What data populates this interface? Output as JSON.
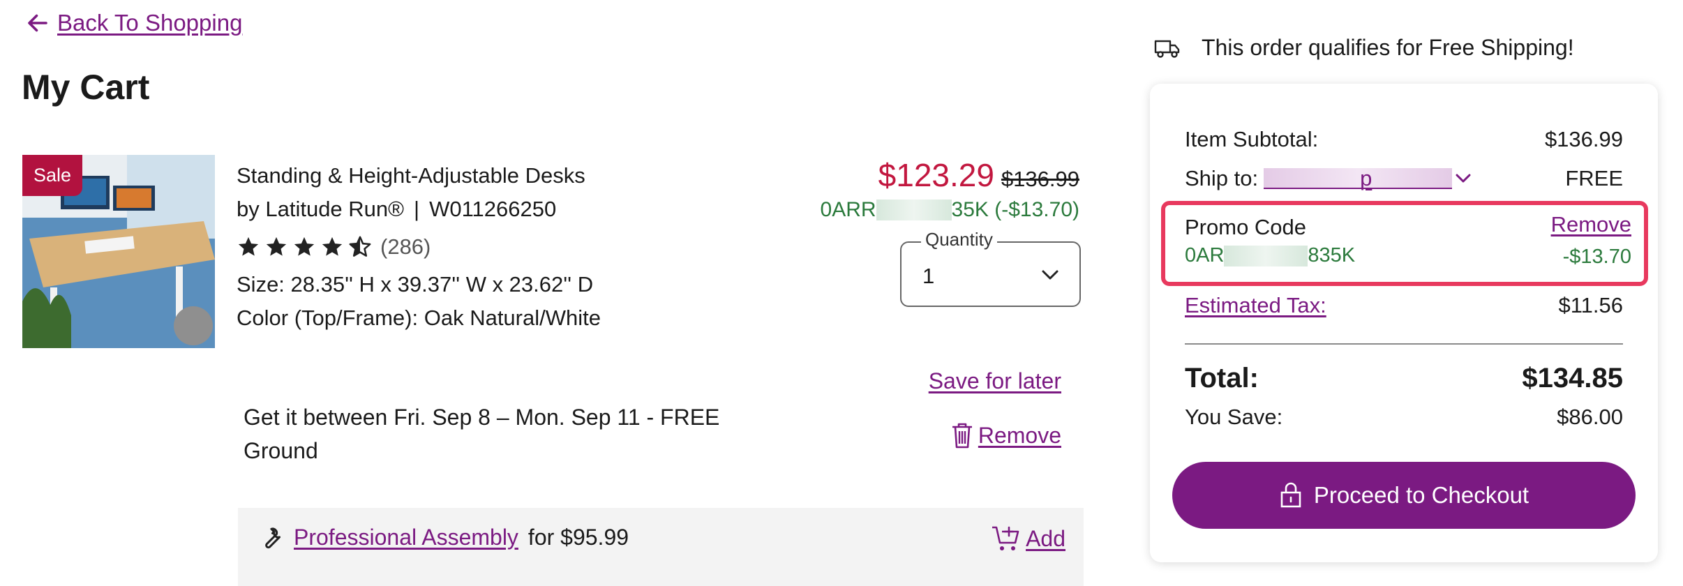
{
  "nav": {
    "back_label": "Back To Shopping"
  },
  "page": {
    "title": "My Cart"
  },
  "item": {
    "badge": "Sale",
    "name": "Standing & Height-Adjustable Desks",
    "brand": "by Latitude Run®",
    "separator": "|",
    "sku": "W011266250",
    "rating": 4.5,
    "review_count": "(286)",
    "size": "Size: 28.35'' H x 39.37'' W x 23.62'' D",
    "color": "Color (Top/Frame): Oak Natural/White",
    "sale_price": "$123.29",
    "original_price": "$136.99",
    "promo_prefix": "0ARR",
    "promo_suffix": "35K (-$13.70)",
    "quantity_label": "Quantity",
    "quantity_value": "1",
    "save_for_later": "Save for later",
    "delivery": "Get it between Fri. Sep 8 – Mon. Sep 11 - FREE Ground",
    "remove_label": "Remove"
  },
  "services": {
    "assembly_link": "Professional Assembly",
    "assembly_price": "for $95.99",
    "add_label": "Add"
  },
  "summary": {
    "free_shipping": "This order qualifies for Free Shipping!",
    "subtotal_label": "Item Subtotal:",
    "subtotal_value": "$136.99",
    "ship_to_label": "Ship to:",
    "ship_to_suffix": "p",
    "ship_value": "FREE",
    "promo_label": "Promo Code",
    "promo_remove": "Remove",
    "promo_code_prefix": "0AR",
    "promo_code_suffix": "835K",
    "promo_amount": "-$13.70",
    "tax_label": "Estimated Tax:",
    "tax_value": "$11.56",
    "total_label": "Total:",
    "total_value": "$134.85",
    "save_label": "You Save:",
    "save_value": "$86.00",
    "checkout_label": "Proceed to Checkout"
  },
  "colors": {
    "brand": "#7b1a82",
    "sale": "#c2173f",
    "promo_green": "#2b7a3c",
    "highlight": "#e8395e"
  }
}
